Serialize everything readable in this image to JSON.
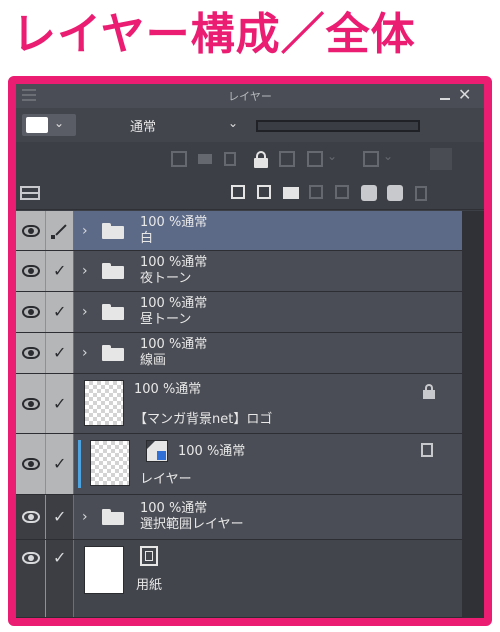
{
  "heading": "レイヤー構成／全体",
  "colors": {
    "accent": "#ea1d73",
    "panel_bg": "#3c3f46",
    "row_bg": "#4a4d55",
    "selected_row_bg": "#5c6a88",
    "active_marker": "#4da3e0"
  },
  "panel": {
    "title": "レイヤー",
    "blend_mode": "通常",
    "main_color_swatch": "#ffffff"
  },
  "layers": [
    {
      "mode": "100 %通常",
      "name": "白",
      "kind": "folder",
      "selected": true,
      "edit_icon": "pen-icon"
    },
    {
      "mode": "100 %通常",
      "name": "夜トーン",
      "kind": "folder"
    },
    {
      "mode": "100 %通常",
      "name": "昼トーン",
      "kind": "folder"
    },
    {
      "mode": "100 %通常",
      "name": "線画",
      "kind": "folder"
    },
    {
      "mode": "100 %通常",
      "name": "【マンガ背景net】ロゴ",
      "kind": "raster",
      "locked": true,
      "status_icon": "lock-icon"
    },
    {
      "mode": "100 %通常",
      "name": "レイヤー",
      "kind": "raster",
      "active": true,
      "type_icon": "raster-layer-icon",
      "status_icon": "reference-layer-icon"
    },
    {
      "mode": "100 %通常",
      "name": "選択範囲レイヤー",
      "kind": "folder",
      "dim_visibility": true
    },
    {
      "mode": "",
      "name": "用紙",
      "kind": "paper",
      "dim_visibility": true,
      "type_icon": "paper-layer-icon"
    }
  ]
}
